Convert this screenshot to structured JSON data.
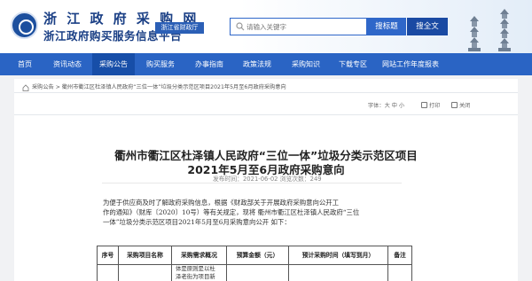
{
  "header": {
    "site_title": "浙 江 政 府 采 购 网",
    "site_subtitle": "浙江政府购买服务信息平台",
    "dept_badge": "浙江省财政厅",
    "search_placeholder": "请输入关键字",
    "search_site_button": "搜标题",
    "search_all_button": "搜全文"
  },
  "nav": {
    "items": [
      "首页",
      "资讯动态",
      "采购公告",
      "购买服务",
      "办事指南",
      "政策法规",
      "采购知识",
      "下载专区",
      "网站工作年度报表"
    ],
    "active_index": 2
  },
  "breadcrumb": {
    "text": "采购公告 > 衢州市衢江区杜泽镇人民政府“三位一体”垃圾分类示范区项目2021年5月至6月政府采购意向"
  },
  "tools": {
    "font_label": "字体：",
    "font_size_label": "大 中 小",
    "print_label": "打印",
    "close_label": "关闭"
  },
  "article": {
    "title_line1": "衢州市衢江区杜泽镇人民政府“三位一体”垃圾分类示范区项目",
    "title_line2": "2021年5月至6月政府采购意向",
    "meta": "发布时间：2021-06-02    浏览次数：249",
    "para_line1": "为便于供应商及时了解政府采购信息，根据《财政部关于开展政府采购意向公开工",
    "para_line2": "作的通知》（财库〔2020〕10号）等有关规定，现将 衢州市衢江区杜泽镇人民政府“三位",
    "para_line3": "一体”垃圾分类示范区项目2021年5月至6月采购意向公开 如下："
  },
  "table": {
    "headers": [
      "序号",
      "采购项目名称",
      "采购需求概况",
      "预算金额（元）",
      "预计采购时间（填写到月）",
      "备注"
    ],
    "row1_demand_line1": "体是原则是以杜",
    "row1_demand_line2": "泽老街为项目新"
  },
  "colors": {
    "brand_blue": "#2a64c4",
    "nav_active": "#174ea8",
    "title_blue": "#1a3f85"
  }
}
